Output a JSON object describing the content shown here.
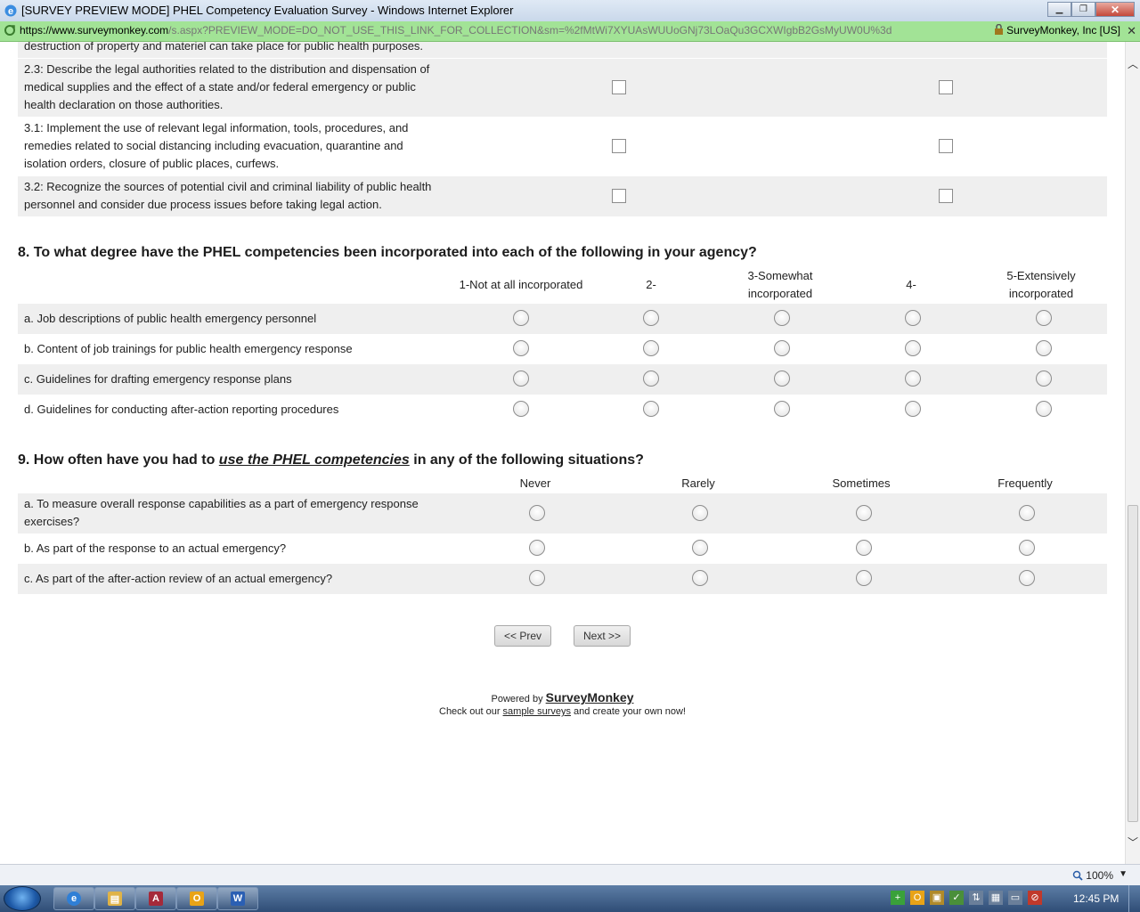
{
  "window": {
    "title": "[SURVEY PREVIEW MODE] PHEL Competency Evaluation Survey - Windows Internet Explorer",
    "min_label": "▁",
    "restore_label": "❐",
    "close_label": "✕"
  },
  "address_bar": {
    "url_prefix": "https://www.",
    "url_host": "surveymonkey.com",
    "url_path": "/s.aspx?PREVIEW_MODE=DO_NOT_USE_THIS_LINK_FOR_COLLECTION&sm=%2fMtWi7XYUAsWUUoGNj73LOaQu3GCXWIgbB2GsMyUW0U%3d",
    "security_label": "SurveyMonkey, Inc [US]"
  },
  "cutoff_text": "destruction of property and materiel can take place for public health purposes.",
  "q7_rows": [
    {
      "id": "2.3",
      "lines": [
        "2.3: Describe the legal authorities related to the distribution and dispensation of",
        "medical supplies and the effect of a state and/or federal emergency or public",
        "health declaration on those authorities."
      ]
    },
    {
      "id": "3.1",
      "lines": [
        "3.1: Implement the use of relevant legal information, tools, procedures, and",
        "remedies related to social distancing including evacuation, quarantine and",
        "isolation orders, closure of public places, curfews."
      ]
    },
    {
      "id": "3.2",
      "lines": [
        "3.2: Recognize the sources of potential civil and criminal liability of public health",
        "personnel and consider due process issues before taking legal action."
      ]
    }
  ],
  "q8": {
    "title": "8. To what degree have the PHEL competencies been incorporated into each of the following in your agency?",
    "columns": [
      {
        "lines": [
          "1-Not at all incorporated"
        ]
      },
      {
        "lines": [
          "2-"
        ]
      },
      {
        "lines": [
          "3-Somewhat",
          "incorporated"
        ]
      },
      {
        "lines": [
          "4-"
        ]
      },
      {
        "lines": [
          "5-Extensively",
          "incorporated"
        ]
      }
    ],
    "rows": [
      "a. Job descriptions of public health emergency personnel",
      "b. Content of job trainings for public health emergency response",
      "c. Guidelines for drafting emergency response plans",
      "d. Guidelines for conducting after-action reporting procedures"
    ]
  },
  "q9": {
    "title_before": "9. How often have you had to ",
    "title_emph": "use the PHEL competencies",
    "title_after": " in any of the following situations?",
    "columns": [
      "Never",
      "Rarely",
      "Sometimes",
      "Frequently"
    ],
    "rows": [
      [
        "a. To measure overall response capabilities as a part of emergency response",
        "exercises?"
      ],
      [
        "b. As part of the response to an actual emergency?"
      ],
      [
        "c. As part of the after-action review of an actual emergency?"
      ]
    ]
  },
  "nav": {
    "prev_label": "<< Prev",
    "next_label": "Next >>"
  },
  "footer": {
    "powered_by": "Powered by ",
    "brand": "SurveyMonkey",
    "check_out": "Check out our ",
    "sample_link": "sample surveys",
    "create_text": " and create your own now!"
  },
  "statusbar": {
    "zoom_label": "100%",
    "zoom_dropdown": "▼"
  },
  "taskbar": {
    "apps": [
      {
        "name": "internet-explorer",
        "glyph": "e",
        "color": "#2f7fd6"
      },
      {
        "name": "windows-explorer",
        "glyph": "▤",
        "color": "#e0b347"
      },
      {
        "name": "access",
        "glyph": "A",
        "color": "#a52a3a"
      },
      {
        "name": "outlook",
        "glyph": "O",
        "color": "#e8a317"
      },
      {
        "name": "word",
        "glyph": "W",
        "color": "#2b5fb3"
      }
    ],
    "clock": "12:45 PM"
  }
}
